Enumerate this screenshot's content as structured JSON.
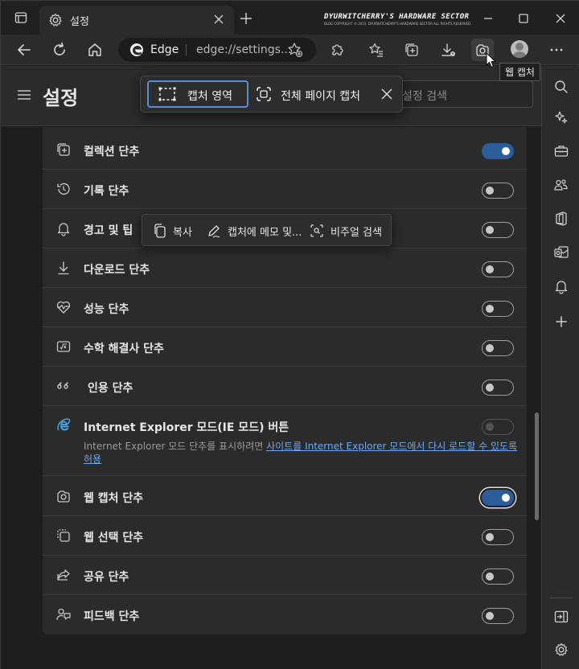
{
  "window": {
    "tab_title": "설정",
    "brand_line1": "DYURWITCHERRY'S HARDWARE SECTOR",
    "brand_line2": "BLOG COPYRIGHT © 2015. DYURWITCHERRY'S HARDWARE SECTOR ALL RIGHTS RESERVED."
  },
  "toolbar": {
    "edge_label": "Edge",
    "url": "edge://settings...",
    "tooltip": "웹 캡처"
  },
  "settings": {
    "title": "설정",
    "search_placeholder": "설정 검색"
  },
  "capture_bar": {
    "area_label": "캡처 영역",
    "full_label": "전체 페이지 캡처"
  },
  "context_menu": {
    "copy": "복사",
    "annotate": "캡처에 메모 및...",
    "visual_search": "비주얼 검색"
  },
  "rows": [
    {
      "label": "컬렉션 단추",
      "icon": "collections-icon",
      "on": true
    },
    {
      "label": "기록 단추",
      "icon": "history-icon",
      "on": false
    },
    {
      "label": "경고 및 팁",
      "icon": "bell-icon",
      "on": false
    },
    {
      "label": "다운로드 단추",
      "icon": "download-icon",
      "on": false
    },
    {
      "label": "성능 단추",
      "icon": "heartbeat-icon",
      "on": false
    },
    {
      "label": "수학 해결사 단추",
      "icon": "math-icon",
      "on": false
    },
    {
      "label": "인용 단추",
      "icon": "quote-icon",
      "on": false
    },
    {
      "label": "Internet Explorer 모드(IE 모드) 버튼",
      "icon": "ie-icon",
      "on": false,
      "disabled": true
    },
    {
      "label": "웹 캡처 단추",
      "icon": "web-capture-icon",
      "on": true
    },
    {
      "label": "웹 선택 단추",
      "icon": "web-select-icon",
      "on": false
    },
    {
      "label": "공유 단추",
      "icon": "share-icon",
      "on": false
    },
    {
      "label": "피드백 단추",
      "icon": "feedback-icon",
      "on": false
    }
  ],
  "ie_description": {
    "prefix": "Internet Explorer 모드 단추를 표시하려면 ",
    "link": "사이트를 Internet Explorer 모드에서 다시 로드할 수 있도록 허용"
  },
  "colors": {
    "toggle_on": "#2a5d9a",
    "accent_border": "#5a8ed0",
    "link": "#6ea8ee"
  }
}
